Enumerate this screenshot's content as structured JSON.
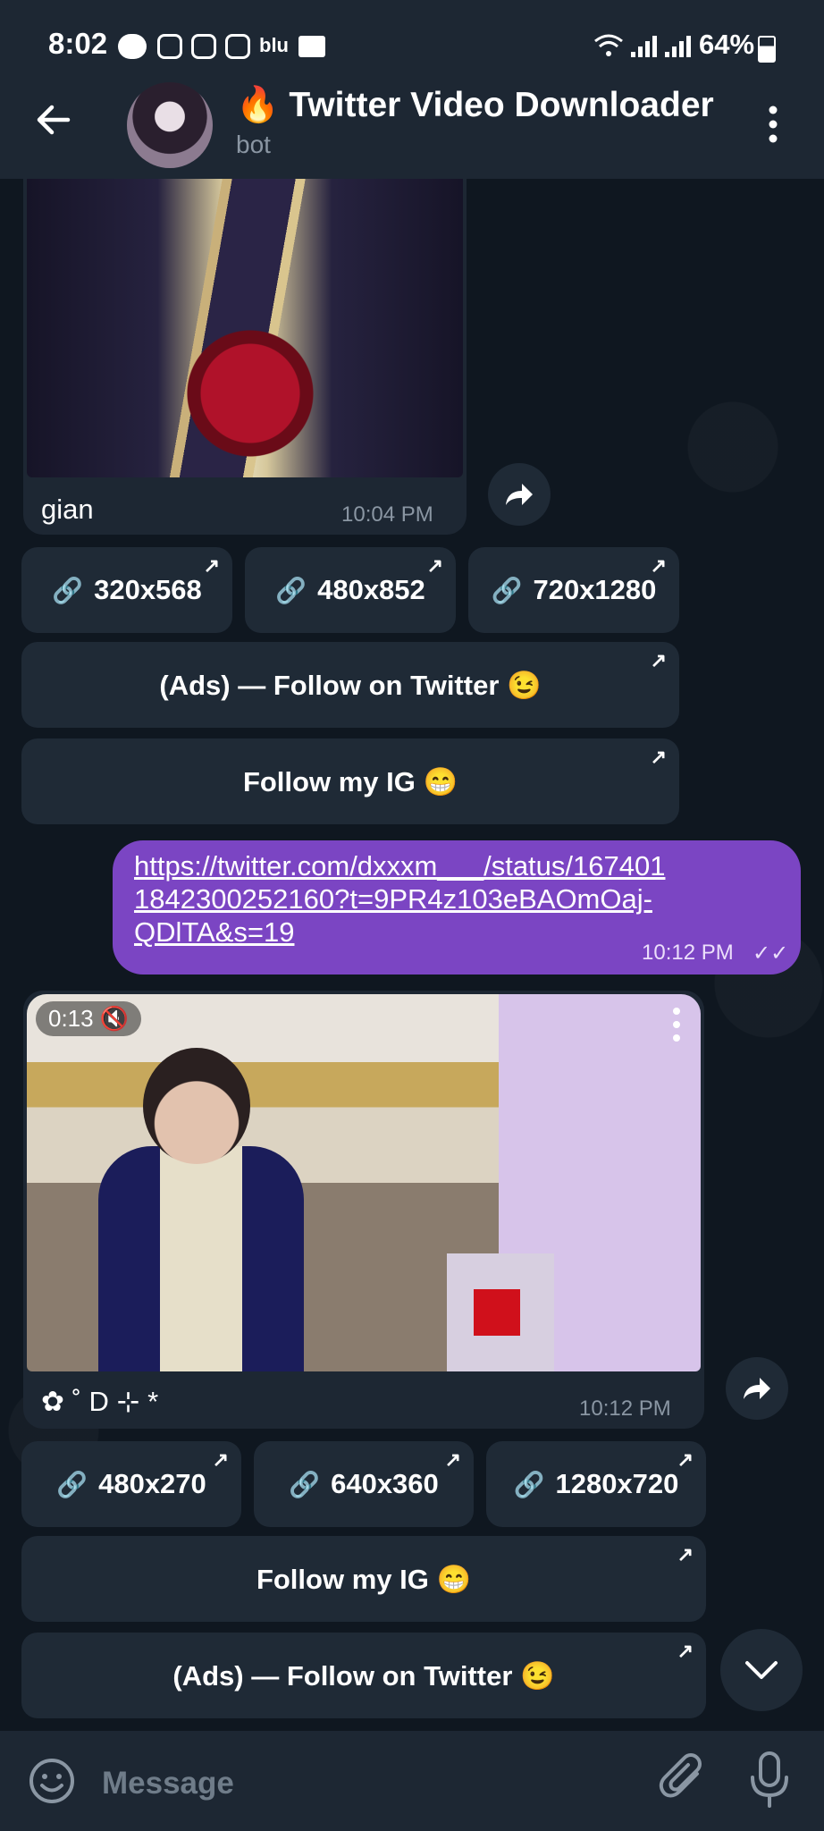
{
  "status_bar": {
    "time": "8:02",
    "app_icons": [
      "line-icon",
      "instagram-icon",
      "instagram-icon",
      "instagram-icon",
      "blu-icon",
      "mail-icon"
    ],
    "blu_label": "blu",
    "battery": "64%"
  },
  "header": {
    "emoji": "🔥",
    "title": "Twitter Video Downloader",
    "subtitle": "bot"
  },
  "messages": {
    "first": {
      "caption": "gian",
      "time": "10:04 PM",
      "buttons": [
        "320x568",
        "480x852",
        "720x1280"
      ],
      "ads_button": "(Ads) — Follow on Twitter 😉",
      "ig_button": "Follow my IG 😁"
    },
    "outgoing": {
      "text": "https://twitter.com/dxxxm___/status/1674011842300252160?t=9PR4z103eBAOmOaj-QDlTA&s=19",
      "time": "10:12 PM",
      "ticks": "✓✓"
    },
    "second": {
      "duration": "0:13",
      "mute_icon": "🔇",
      "caption": "✿ ˚ D ꒰ * ꒱ *",
      "caption_display": "✿ ˚ D ⊹ *",
      "time": "10:12 PM",
      "buttons": [
        "480x270",
        "640x360",
        "1280x720"
      ],
      "ig_button": "Follow my IG 😁",
      "ads_button": "(Ads) — Follow on Twitter 😉"
    }
  },
  "input": {
    "placeholder": "Message"
  },
  "colors": {
    "background": "#0f1720",
    "bar": "#1d2733",
    "outgoing_bubble": "#7b45c3",
    "secondary_text": "#8a96a3"
  }
}
